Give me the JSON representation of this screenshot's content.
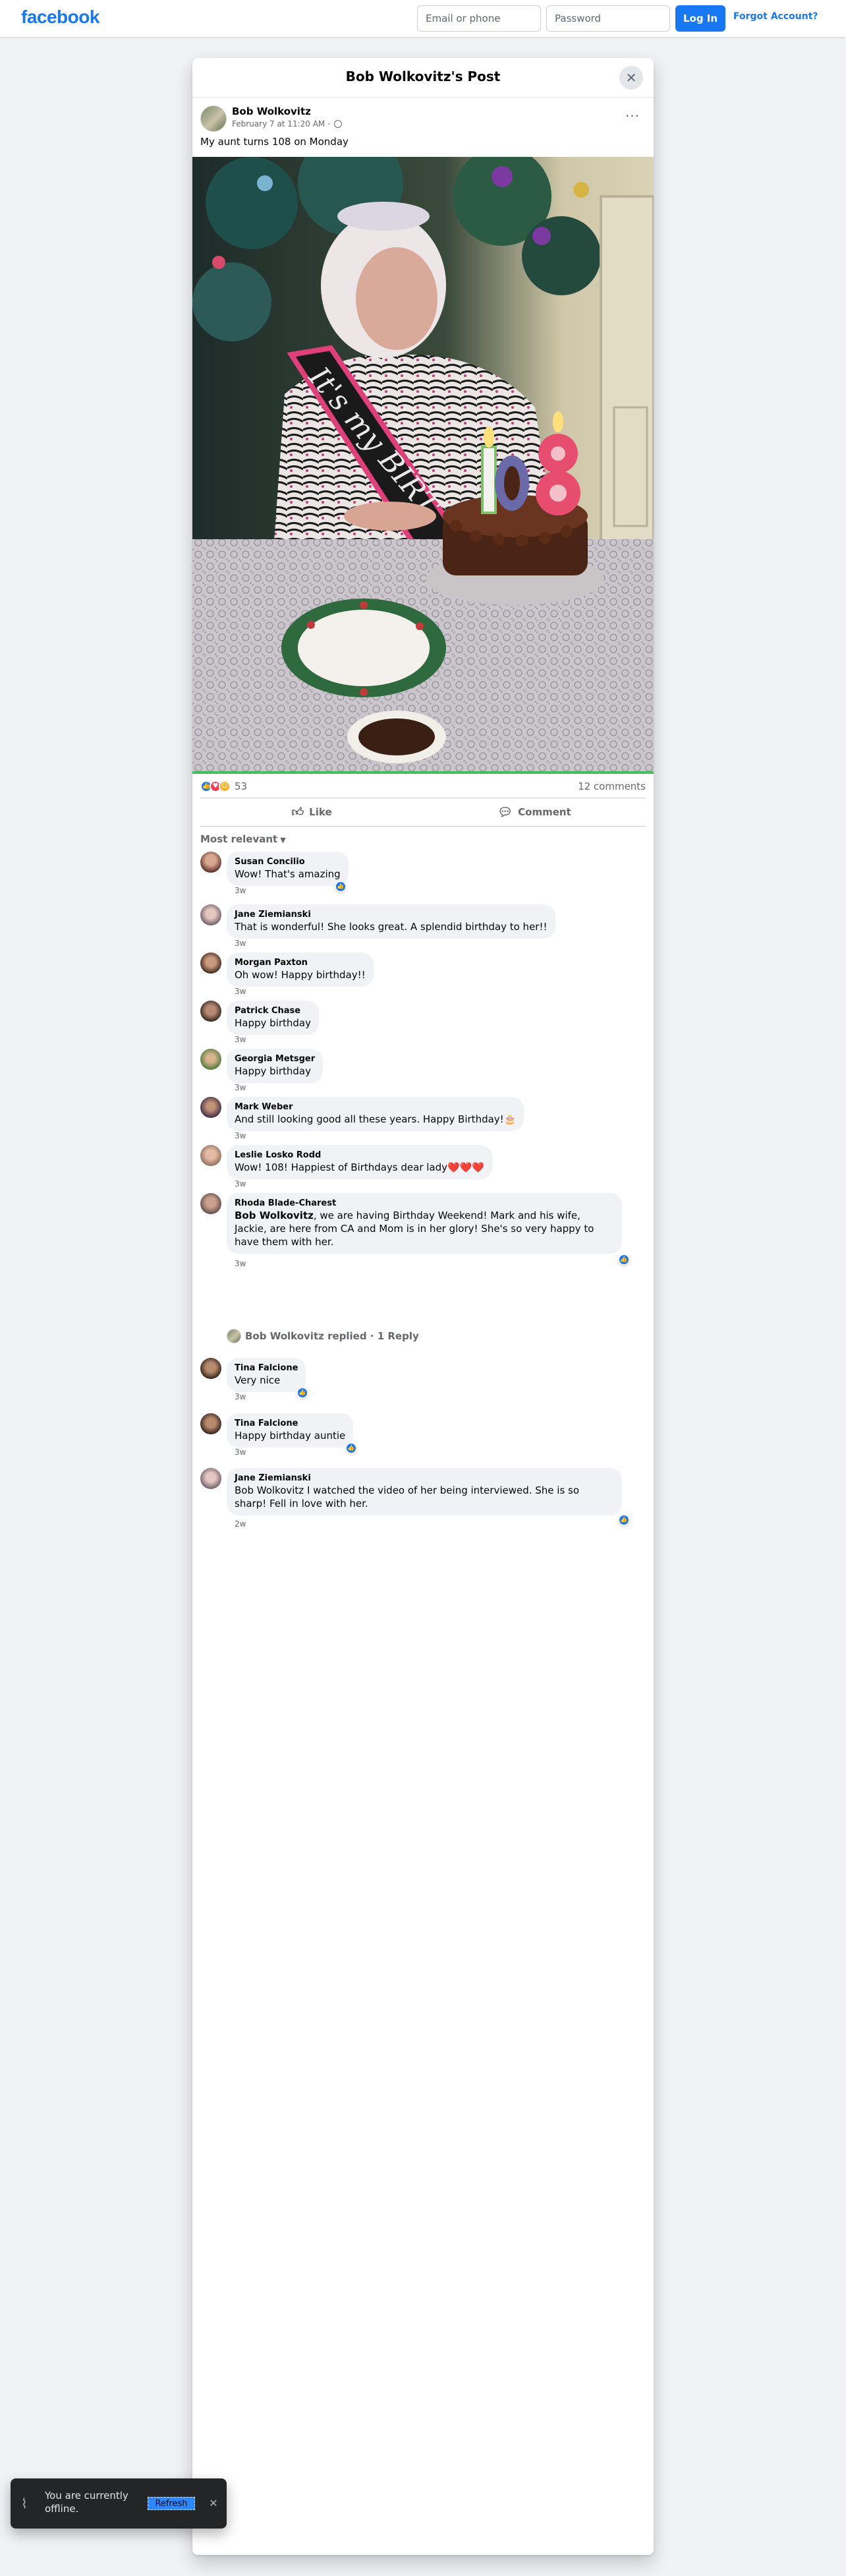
{
  "topbar": {
    "logo": "facebook",
    "email_placeholder": "Email or phone",
    "password_placeholder": "Password",
    "login_label": "Log In",
    "forgot_label": "Forgot Account?"
  },
  "modal": {
    "title": "Bob Wolkovitz's Post",
    "close_icon": "close-icon"
  },
  "post": {
    "author": "Bob Wolkovitz",
    "date": "February 7 at 11:20 AM",
    "separator": "·",
    "privacy_icon": "globe-icon",
    "text": "My aunt turns 108 on Monday",
    "photo": {
      "sash_text": "It's my BIRT",
      "candles": "108"
    },
    "reaction_count": "53",
    "comment_count": "12 comments",
    "like_label": "Like",
    "comment_label": "Comment"
  },
  "sort_label": "Most relevant",
  "comments": [
    {
      "name": "Susan Concilio",
      "text": "Wow! That's amazing",
      "time": "3w",
      "liked": true
    },
    {
      "name": "Jane Ziemianski",
      "text": "That is wonderful! She looks great. A splendid birthday to her!!",
      "time": "3w",
      "liked": false
    },
    {
      "name": "Morgan Paxton",
      "text": "Oh wow! Happy birthday!!",
      "time": "3w",
      "liked": false
    },
    {
      "name": "Patrick Chase",
      "text": "Happy birthday",
      "time": "3w",
      "liked": false
    },
    {
      "name": "Georgia Metsger",
      "text": "Happy birthday",
      "time": "3w",
      "liked": false
    },
    {
      "name": "Mark Weber",
      "text": "And still looking good all these years. Happy Birthday!",
      "emoji": "🎂",
      "time": "3w",
      "liked": false
    },
    {
      "name": "Leslie Losko Rodd",
      "text": "Wow! 108! Happiest of Birthdays dear lady",
      "emoji": "❤️❤️❤️",
      "time": "3w",
      "liked": false
    },
    {
      "name": "Rhoda Blade-Charest",
      "mention": "Bob Wolkovitz",
      "text": ", we are having Birthday Weekend! Mark and his wife, Jackie, are here from CA and Mom is in her glory! She's so very happy to have them with her.",
      "time": "3w",
      "liked": true
    },
    {
      "name": "Tina Falcione",
      "text": "Very nice",
      "time": "3w",
      "liked": true
    },
    {
      "name": "Tina Falcione",
      "text": "Happy birthday auntie",
      "time": "3w",
      "liked": true
    },
    {
      "name": "Jane Ziemianski",
      "text": "Bob Wolkovitz I watched the video of her being interviewed. She is so sharp! Fell in love with her.",
      "time": "2w",
      "liked": true
    }
  ],
  "reply_summary": "Bob Wolkovitz replied · 1 Reply",
  "toast": {
    "message": "You are currently offline.",
    "refresh_label": "Refresh",
    "icon": "wifi-off-icon"
  },
  "colors": {
    "brand": "#1877f2",
    "background": "#f0f2f5",
    "bubble": "#f0f2f5",
    "muted": "#65676b",
    "toast_bg": "#242526"
  }
}
